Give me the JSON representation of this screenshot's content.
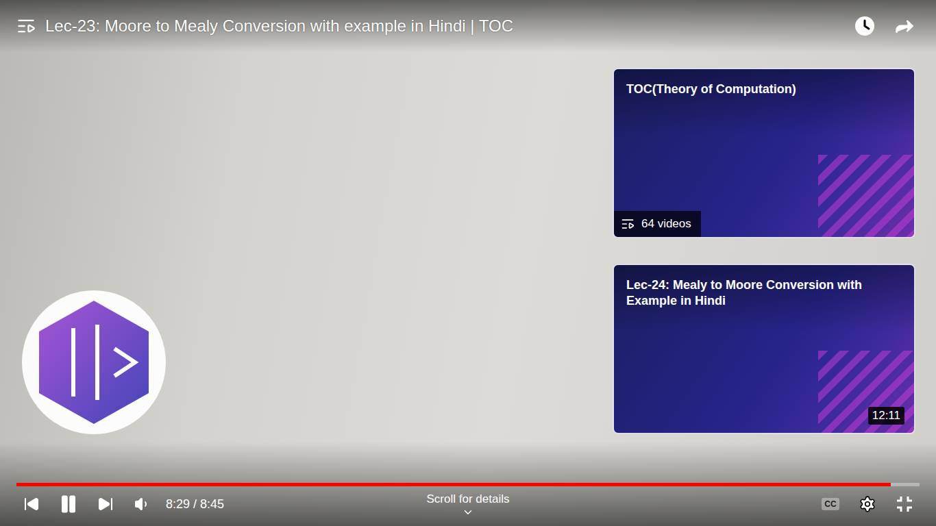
{
  "player": {
    "title": "Lec-23: Moore to Mealy Conversion with example in Hindi | TOC",
    "playing": true,
    "progress": {
      "level": 0.968
    },
    "time": "8:29 / 8:45",
    "scroll_hint": "Scroll for details",
    "captions": {
      "label": "CC",
      "on": false
    }
  },
  "end_cards": [
    {
      "kind": "playlist",
      "title": "TOC(Theory of Computation)",
      "count": "64 videos"
    },
    {
      "kind": "video",
      "title": "Lec-24: Mealy to Moore Conversion with Example in Hindi",
      "duration": "12:11"
    }
  ]
}
